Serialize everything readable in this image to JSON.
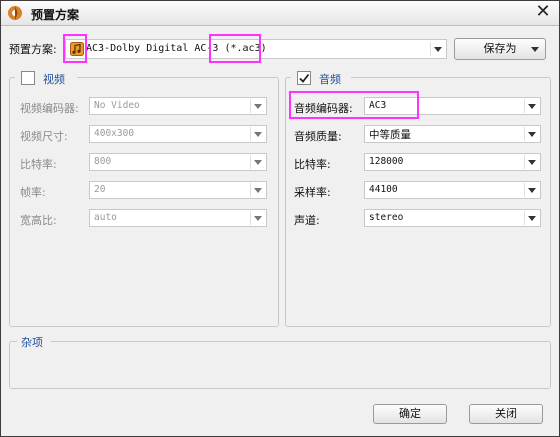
{
  "window": {
    "title": "预置方案",
    "close_glyph": "✕"
  },
  "preset": {
    "label": "预置方案:",
    "value": "AC3-Dolby Digital AC-3 (*.ac3)",
    "save_as": "保存为"
  },
  "video": {
    "header": "视频",
    "enabled": false,
    "rows": [
      {
        "label": "视频编码器:",
        "value": "No Video"
      },
      {
        "label": "视频尺寸:",
        "value": "400x300"
      },
      {
        "label": "比特率:",
        "value": "800"
      },
      {
        "label": "帧率:",
        "value": "20"
      },
      {
        "label": "宽高比:",
        "value": "auto"
      }
    ]
  },
  "audio": {
    "header": "音频",
    "enabled": true,
    "rows": [
      {
        "label": "音频编码器:",
        "value": "AC3"
      },
      {
        "label": "音频质量:",
        "value": "中等质量"
      },
      {
        "label": "比特率:",
        "value": "128000"
      },
      {
        "label": "采样率:",
        "value": "44100"
      },
      {
        "label": "声道:",
        "value": "stereo"
      }
    ]
  },
  "misc": {
    "header": "杂项"
  },
  "buttons": {
    "ok": "确定",
    "close": "关闭"
  },
  "colors": {
    "highlight": "#ff33ff",
    "section_header": "#1f4e99"
  }
}
